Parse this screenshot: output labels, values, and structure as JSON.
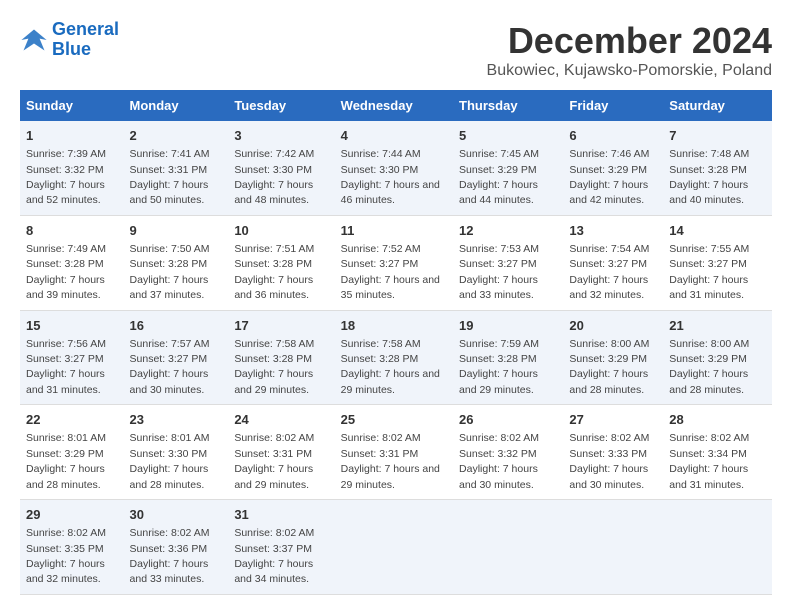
{
  "logo": {
    "line1": "General",
    "line2": "Blue"
  },
  "title": "December 2024",
  "subtitle": "Bukowiec, Kujawsko-Pomorskie, Poland",
  "days_header": [
    "Sunday",
    "Monday",
    "Tuesday",
    "Wednesday",
    "Thursday",
    "Friday",
    "Saturday"
  ],
  "weeks": [
    [
      {
        "day": "1",
        "sunrise": "Sunrise: 7:39 AM",
        "sunset": "Sunset: 3:32 PM",
        "daylight": "Daylight: 7 hours and 52 minutes."
      },
      {
        "day": "2",
        "sunrise": "Sunrise: 7:41 AM",
        "sunset": "Sunset: 3:31 PM",
        "daylight": "Daylight: 7 hours and 50 minutes."
      },
      {
        "day": "3",
        "sunrise": "Sunrise: 7:42 AM",
        "sunset": "Sunset: 3:30 PM",
        "daylight": "Daylight: 7 hours and 48 minutes."
      },
      {
        "day": "4",
        "sunrise": "Sunrise: 7:44 AM",
        "sunset": "Sunset: 3:30 PM",
        "daylight": "Daylight: 7 hours and 46 minutes."
      },
      {
        "day": "5",
        "sunrise": "Sunrise: 7:45 AM",
        "sunset": "Sunset: 3:29 PM",
        "daylight": "Daylight: 7 hours and 44 minutes."
      },
      {
        "day": "6",
        "sunrise": "Sunrise: 7:46 AM",
        "sunset": "Sunset: 3:29 PM",
        "daylight": "Daylight: 7 hours and 42 minutes."
      },
      {
        "day": "7",
        "sunrise": "Sunrise: 7:48 AM",
        "sunset": "Sunset: 3:28 PM",
        "daylight": "Daylight: 7 hours and 40 minutes."
      }
    ],
    [
      {
        "day": "8",
        "sunrise": "Sunrise: 7:49 AM",
        "sunset": "Sunset: 3:28 PM",
        "daylight": "Daylight: 7 hours and 39 minutes."
      },
      {
        "day": "9",
        "sunrise": "Sunrise: 7:50 AM",
        "sunset": "Sunset: 3:28 PM",
        "daylight": "Daylight: 7 hours and 37 minutes."
      },
      {
        "day": "10",
        "sunrise": "Sunrise: 7:51 AM",
        "sunset": "Sunset: 3:28 PM",
        "daylight": "Daylight: 7 hours and 36 minutes."
      },
      {
        "day": "11",
        "sunrise": "Sunrise: 7:52 AM",
        "sunset": "Sunset: 3:27 PM",
        "daylight": "Daylight: 7 hours and 35 minutes."
      },
      {
        "day": "12",
        "sunrise": "Sunrise: 7:53 AM",
        "sunset": "Sunset: 3:27 PM",
        "daylight": "Daylight: 7 hours and 33 minutes."
      },
      {
        "day": "13",
        "sunrise": "Sunrise: 7:54 AM",
        "sunset": "Sunset: 3:27 PM",
        "daylight": "Daylight: 7 hours and 32 minutes."
      },
      {
        "day": "14",
        "sunrise": "Sunrise: 7:55 AM",
        "sunset": "Sunset: 3:27 PM",
        "daylight": "Daylight: 7 hours and 31 minutes."
      }
    ],
    [
      {
        "day": "15",
        "sunrise": "Sunrise: 7:56 AM",
        "sunset": "Sunset: 3:27 PM",
        "daylight": "Daylight: 7 hours and 31 minutes."
      },
      {
        "day": "16",
        "sunrise": "Sunrise: 7:57 AM",
        "sunset": "Sunset: 3:27 PM",
        "daylight": "Daylight: 7 hours and 30 minutes."
      },
      {
        "day": "17",
        "sunrise": "Sunrise: 7:58 AM",
        "sunset": "Sunset: 3:28 PM",
        "daylight": "Daylight: 7 hours and 29 minutes."
      },
      {
        "day": "18",
        "sunrise": "Sunrise: 7:58 AM",
        "sunset": "Sunset: 3:28 PM",
        "daylight": "Daylight: 7 hours and 29 minutes."
      },
      {
        "day": "19",
        "sunrise": "Sunrise: 7:59 AM",
        "sunset": "Sunset: 3:28 PM",
        "daylight": "Daylight: 7 hours and 29 minutes."
      },
      {
        "day": "20",
        "sunrise": "Sunrise: 8:00 AM",
        "sunset": "Sunset: 3:29 PM",
        "daylight": "Daylight: 7 hours and 28 minutes."
      },
      {
        "day": "21",
        "sunrise": "Sunrise: 8:00 AM",
        "sunset": "Sunset: 3:29 PM",
        "daylight": "Daylight: 7 hours and 28 minutes."
      }
    ],
    [
      {
        "day": "22",
        "sunrise": "Sunrise: 8:01 AM",
        "sunset": "Sunset: 3:29 PM",
        "daylight": "Daylight: 7 hours and 28 minutes."
      },
      {
        "day": "23",
        "sunrise": "Sunrise: 8:01 AM",
        "sunset": "Sunset: 3:30 PM",
        "daylight": "Daylight: 7 hours and 28 minutes."
      },
      {
        "day": "24",
        "sunrise": "Sunrise: 8:02 AM",
        "sunset": "Sunset: 3:31 PM",
        "daylight": "Daylight: 7 hours and 29 minutes."
      },
      {
        "day": "25",
        "sunrise": "Sunrise: 8:02 AM",
        "sunset": "Sunset: 3:31 PM",
        "daylight": "Daylight: 7 hours and 29 minutes."
      },
      {
        "day": "26",
        "sunrise": "Sunrise: 8:02 AM",
        "sunset": "Sunset: 3:32 PM",
        "daylight": "Daylight: 7 hours and 30 minutes."
      },
      {
        "day": "27",
        "sunrise": "Sunrise: 8:02 AM",
        "sunset": "Sunset: 3:33 PM",
        "daylight": "Daylight: 7 hours and 30 minutes."
      },
      {
        "day": "28",
        "sunrise": "Sunrise: 8:02 AM",
        "sunset": "Sunset: 3:34 PM",
        "daylight": "Daylight: 7 hours and 31 minutes."
      }
    ],
    [
      {
        "day": "29",
        "sunrise": "Sunrise: 8:02 AM",
        "sunset": "Sunset: 3:35 PM",
        "daylight": "Daylight: 7 hours and 32 minutes."
      },
      {
        "day": "30",
        "sunrise": "Sunrise: 8:02 AM",
        "sunset": "Sunset: 3:36 PM",
        "daylight": "Daylight: 7 hours and 33 minutes."
      },
      {
        "day": "31",
        "sunrise": "Sunrise: 8:02 AM",
        "sunset": "Sunset: 3:37 PM",
        "daylight": "Daylight: 7 hours and 34 minutes."
      },
      {
        "day": "",
        "sunrise": "",
        "sunset": "",
        "daylight": ""
      },
      {
        "day": "",
        "sunrise": "",
        "sunset": "",
        "daylight": ""
      },
      {
        "day": "",
        "sunrise": "",
        "sunset": "",
        "daylight": ""
      },
      {
        "day": "",
        "sunrise": "",
        "sunset": "",
        "daylight": ""
      }
    ]
  ]
}
